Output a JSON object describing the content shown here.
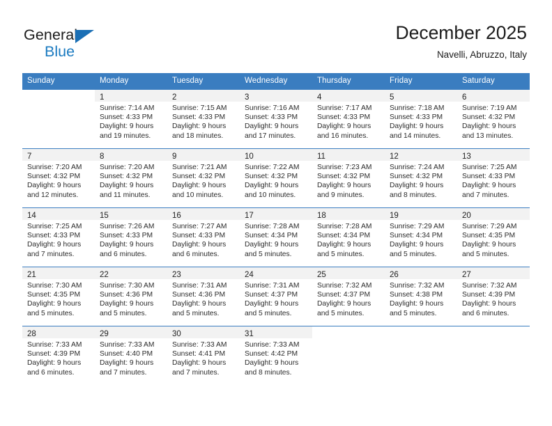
{
  "brand": {
    "name_top": "General",
    "name_bottom": "Blue",
    "accent_color": "#1a7ac0",
    "triangle_color": "#1a6fb5"
  },
  "header": {
    "title": "December 2025",
    "subtitle": "Navelli, Abruzzo, Italy"
  },
  "calendar": {
    "header_bg": "#3a7dc0",
    "header_text_color": "#ffffff",
    "daynum_band_bg": "#f2f2f2",
    "weekdays": [
      "Sunday",
      "Monday",
      "Tuesday",
      "Wednesday",
      "Thursday",
      "Friday",
      "Saturday"
    ],
    "weeks": [
      [
        {
          "day": "",
          "sunrise": "",
          "sunset": "",
          "daylight_line1": "",
          "daylight_line2": ""
        },
        {
          "day": "1",
          "sunrise": "Sunrise: 7:14 AM",
          "sunset": "Sunset: 4:33 PM",
          "daylight_line1": "Daylight: 9 hours",
          "daylight_line2": "and 19 minutes."
        },
        {
          "day": "2",
          "sunrise": "Sunrise: 7:15 AM",
          "sunset": "Sunset: 4:33 PM",
          "daylight_line1": "Daylight: 9 hours",
          "daylight_line2": "and 18 minutes."
        },
        {
          "day": "3",
          "sunrise": "Sunrise: 7:16 AM",
          "sunset": "Sunset: 4:33 PM",
          "daylight_line1": "Daylight: 9 hours",
          "daylight_line2": "and 17 minutes."
        },
        {
          "day": "4",
          "sunrise": "Sunrise: 7:17 AM",
          "sunset": "Sunset: 4:33 PM",
          "daylight_line1": "Daylight: 9 hours",
          "daylight_line2": "and 16 minutes."
        },
        {
          "day": "5",
          "sunrise": "Sunrise: 7:18 AM",
          "sunset": "Sunset: 4:33 PM",
          "daylight_line1": "Daylight: 9 hours",
          "daylight_line2": "and 14 minutes."
        },
        {
          "day": "6",
          "sunrise": "Sunrise: 7:19 AM",
          "sunset": "Sunset: 4:32 PM",
          "daylight_line1": "Daylight: 9 hours",
          "daylight_line2": "and 13 minutes."
        }
      ],
      [
        {
          "day": "7",
          "sunrise": "Sunrise: 7:20 AM",
          "sunset": "Sunset: 4:32 PM",
          "daylight_line1": "Daylight: 9 hours",
          "daylight_line2": "and 12 minutes."
        },
        {
          "day": "8",
          "sunrise": "Sunrise: 7:20 AM",
          "sunset": "Sunset: 4:32 PM",
          "daylight_line1": "Daylight: 9 hours",
          "daylight_line2": "and 11 minutes."
        },
        {
          "day": "9",
          "sunrise": "Sunrise: 7:21 AM",
          "sunset": "Sunset: 4:32 PM",
          "daylight_line1": "Daylight: 9 hours",
          "daylight_line2": "and 10 minutes."
        },
        {
          "day": "10",
          "sunrise": "Sunrise: 7:22 AM",
          "sunset": "Sunset: 4:32 PM",
          "daylight_line1": "Daylight: 9 hours",
          "daylight_line2": "and 10 minutes."
        },
        {
          "day": "11",
          "sunrise": "Sunrise: 7:23 AM",
          "sunset": "Sunset: 4:32 PM",
          "daylight_line1": "Daylight: 9 hours",
          "daylight_line2": "and 9 minutes."
        },
        {
          "day": "12",
          "sunrise": "Sunrise: 7:24 AM",
          "sunset": "Sunset: 4:32 PM",
          "daylight_line1": "Daylight: 9 hours",
          "daylight_line2": "and 8 minutes."
        },
        {
          "day": "13",
          "sunrise": "Sunrise: 7:25 AM",
          "sunset": "Sunset: 4:33 PM",
          "daylight_line1": "Daylight: 9 hours",
          "daylight_line2": "and 7 minutes."
        }
      ],
      [
        {
          "day": "14",
          "sunrise": "Sunrise: 7:25 AM",
          "sunset": "Sunset: 4:33 PM",
          "daylight_line1": "Daylight: 9 hours",
          "daylight_line2": "and 7 minutes."
        },
        {
          "day": "15",
          "sunrise": "Sunrise: 7:26 AM",
          "sunset": "Sunset: 4:33 PM",
          "daylight_line1": "Daylight: 9 hours",
          "daylight_line2": "and 6 minutes."
        },
        {
          "day": "16",
          "sunrise": "Sunrise: 7:27 AM",
          "sunset": "Sunset: 4:33 PM",
          "daylight_line1": "Daylight: 9 hours",
          "daylight_line2": "and 6 minutes."
        },
        {
          "day": "17",
          "sunrise": "Sunrise: 7:28 AM",
          "sunset": "Sunset: 4:34 PM",
          "daylight_line1": "Daylight: 9 hours",
          "daylight_line2": "and 5 minutes."
        },
        {
          "day": "18",
          "sunrise": "Sunrise: 7:28 AM",
          "sunset": "Sunset: 4:34 PM",
          "daylight_line1": "Daylight: 9 hours",
          "daylight_line2": "and 5 minutes."
        },
        {
          "day": "19",
          "sunrise": "Sunrise: 7:29 AM",
          "sunset": "Sunset: 4:34 PM",
          "daylight_line1": "Daylight: 9 hours",
          "daylight_line2": "and 5 minutes."
        },
        {
          "day": "20",
          "sunrise": "Sunrise: 7:29 AM",
          "sunset": "Sunset: 4:35 PM",
          "daylight_line1": "Daylight: 9 hours",
          "daylight_line2": "and 5 minutes."
        }
      ],
      [
        {
          "day": "21",
          "sunrise": "Sunrise: 7:30 AM",
          "sunset": "Sunset: 4:35 PM",
          "daylight_line1": "Daylight: 9 hours",
          "daylight_line2": "and 5 minutes."
        },
        {
          "day": "22",
          "sunrise": "Sunrise: 7:30 AM",
          "sunset": "Sunset: 4:36 PM",
          "daylight_line1": "Daylight: 9 hours",
          "daylight_line2": "and 5 minutes."
        },
        {
          "day": "23",
          "sunrise": "Sunrise: 7:31 AM",
          "sunset": "Sunset: 4:36 PM",
          "daylight_line1": "Daylight: 9 hours",
          "daylight_line2": "and 5 minutes."
        },
        {
          "day": "24",
          "sunrise": "Sunrise: 7:31 AM",
          "sunset": "Sunset: 4:37 PM",
          "daylight_line1": "Daylight: 9 hours",
          "daylight_line2": "and 5 minutes."
        },
        {
          "day": "25",
          "sunrise": "Sunrise: 7:32 AM",
          "sunset": "Sunset: 4:37 PM",
          "daylight_line1": "Daylight: 9 hours",
          "daylight_line2": "and 5 minutes."
        },
        {
          "day": "26",
          "sunrise": "Sunrise: 7:32 AM",
          "sunset": "Sunset: 4:38 PM",
          "daylight_line1": "Daylight: 9 hours",
          "daylight_line2": "and 5 minutes."
        },
        {
          "day": "27",
          "sunrise": "Sunrise: 7:32 AM",
          "sunset": "Sunset: 4:39 PM",
          "daylight_line1": "Daylight: 9 hours",
          "daylight_line2": "and 6 minutes."
        }
      ],
      [
        {
          "day": "28",
          "sunrise": "Sunrise: 7:33 AM",
          "sunset": "Sunset: 4:39 PM",
          "daylight_line1": "Daylight: 9 hours",
          "daylight_line2": "and 6 minutes."
        },
        {
          "day": "29",
          "sunrise": "Sunrise: 7:33 AM",
          "sunset": "Sunset: 4:40 PM",
          "daylight_line1": "Daylight: 9 hours",
          "daylight_line2": "and 7 minutes."
        },
        {
          "day": "30",
          "sunrise": "Sunrise: 7:33 AM",
          "sunset": "Sunset: 4:41 PM",
          "daylight_line1": "Daylight: 9 hours",
          "daylight_line2": "and 7 minutes."
        },
        {
          "day": "31",
          "sunrise": "Sunrise: 7:33 AM",
          "sunset": "Sunset: 4:42 PM",
          "daylight_line1": "Daylight: 9 hours",
          "daylight_line2": "and 8 minutes."
        },
        {
          "day": "",
          "sunrise": "",
          "sunset": "",
          "daylight_line1": "",
          "daylight_line2": ""
        },
        {
          "day": "",
          "sunrise": "",
          "sunset": "",
          "daylight_line1": "",
          "daylight_line2": ""
        },
        {
          "day": "",
          "sunrise": "",
          "sunset": "",
          "daylight_line1": "",
          "daylight_line2": ""
        }
      ]
    ]
  }
}
